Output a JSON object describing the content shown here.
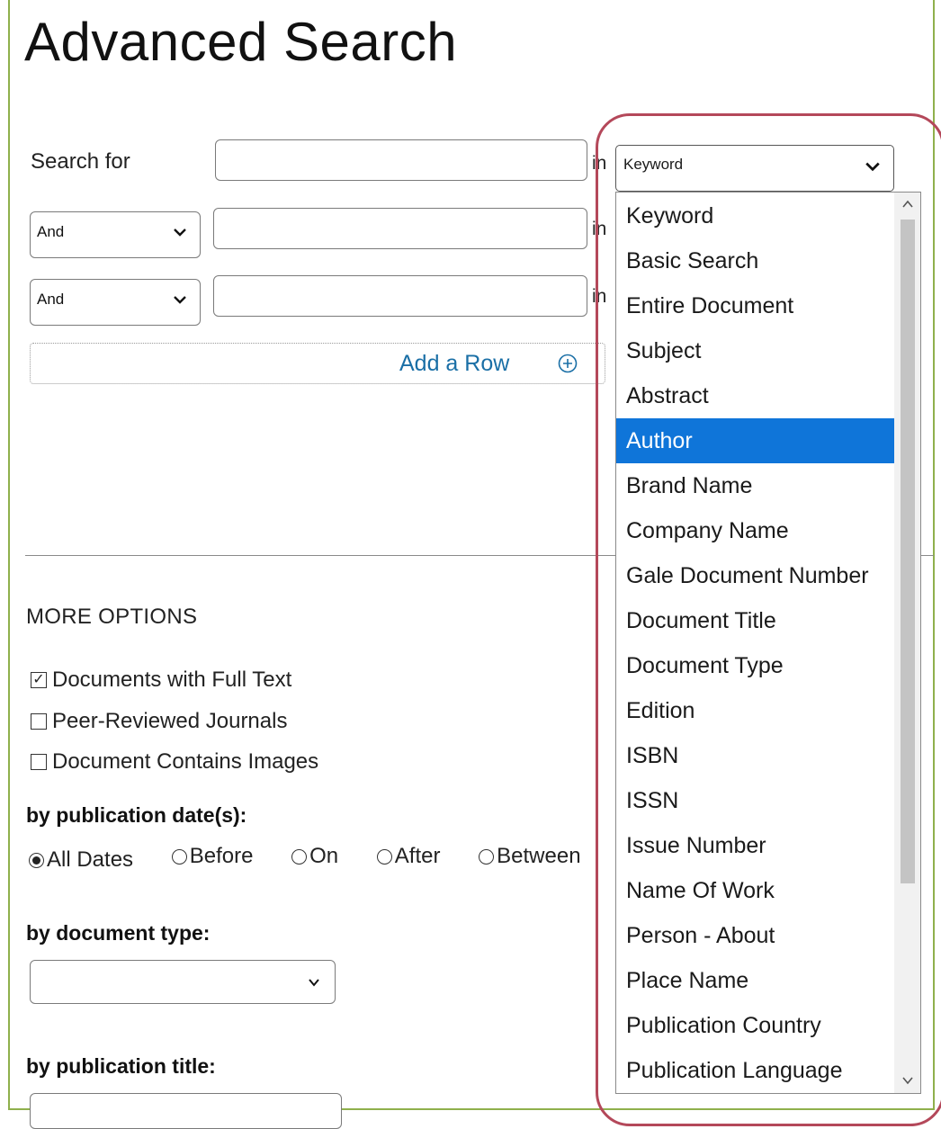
{
  "page": {
    "title": "Advanced Search"
  },
  "search": {
    "search_for_label": "Search for",
    "in_label": "in",
    "field_select_value": "Keyword",
    "rows": [
      {
        "operator": "And"
      },
      {
        "operator": "And"
      }
    ],
    "add_row_label": "Add a Row"
  },
  "field_dropdown": {
    "options": [
      "Keyword",
      "Basic Search",
      "Entire Document",
      "Subject",
      "Abstract",
      "Author",
      "Brand Name",
      "Company Name",
      "Gale Document Number",
      "Document Title",
      "Document Type",
      "Edition",
      "ISBN",
      "ISSN",
      "Issue Number",
      "Name Of Work",
      "Person - About",
      "Place Name",
      "Publication Country",
      "Publication Language"
    ],
    "highlighted": "Author",
    "highlight_color": "#0f75d9"
  },
  "more_options": {
    "heading": "MORE OPTIONS",
    "checkboxes": [
      {
        "label": "Documents with Full Text",
        "checked": true
      },
      {
        "label": "Peer-Reviewed Journals",
        "checked": false
      },
      {
        "label": "Document Contains Images",
        "checked": false
      }
    ],
    "pub_date_heading": "by publication date(s):",
    "date_options": [
      {
        "label": "All Dates",
        "selected": true
      },
      {
        "label": "Before",
        "selected": false
      },
      {
        "label": "On",
        "selected": false
      },
      {
        "label": "After",
        "selected": false
      },
      {
        "label": "Between",
        "selected": false
      }
    ],
    "doc_type_heading": "by document type:",
    "doc_type_value": "",
    "pub_title_heading": "by publication title:"
  },
  "colors": {
    "frame_border": "#8fb04c",
    "link": "#1a6fa6",
    "annotation_ring": "#b4485a"
  }
}
